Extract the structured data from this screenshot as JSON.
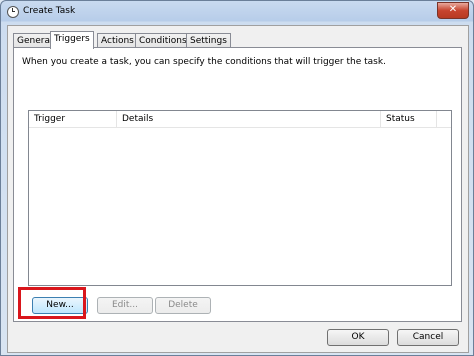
{
  "window": {
    "title": "Create Task"
  },
  "tabs": [
    {
      "label": "General"
    },
    {
      "label": "Triggers",
      "active": true
    },
    {
      "label": "Actions"
    },
    {
      "label": "Conditions"
    },
    {
      "label": "Settings"
    }
  ],
  "triggers": {
    "description": "When you create a task, you can specify the conditions that will trigger the task.",
    "columns": [
      "Trigger",
      "Details",
      "Status"
    ],
    "rows": []
  },
  "buttons": {
    "new": "New...",
    "edit": "Edit...",
    "delete": "Delete",
    "ok": "OK",
    "cancel": "Cancel"
  },
  "colors": {
    "highlight": "#d9161c"
  }
}
